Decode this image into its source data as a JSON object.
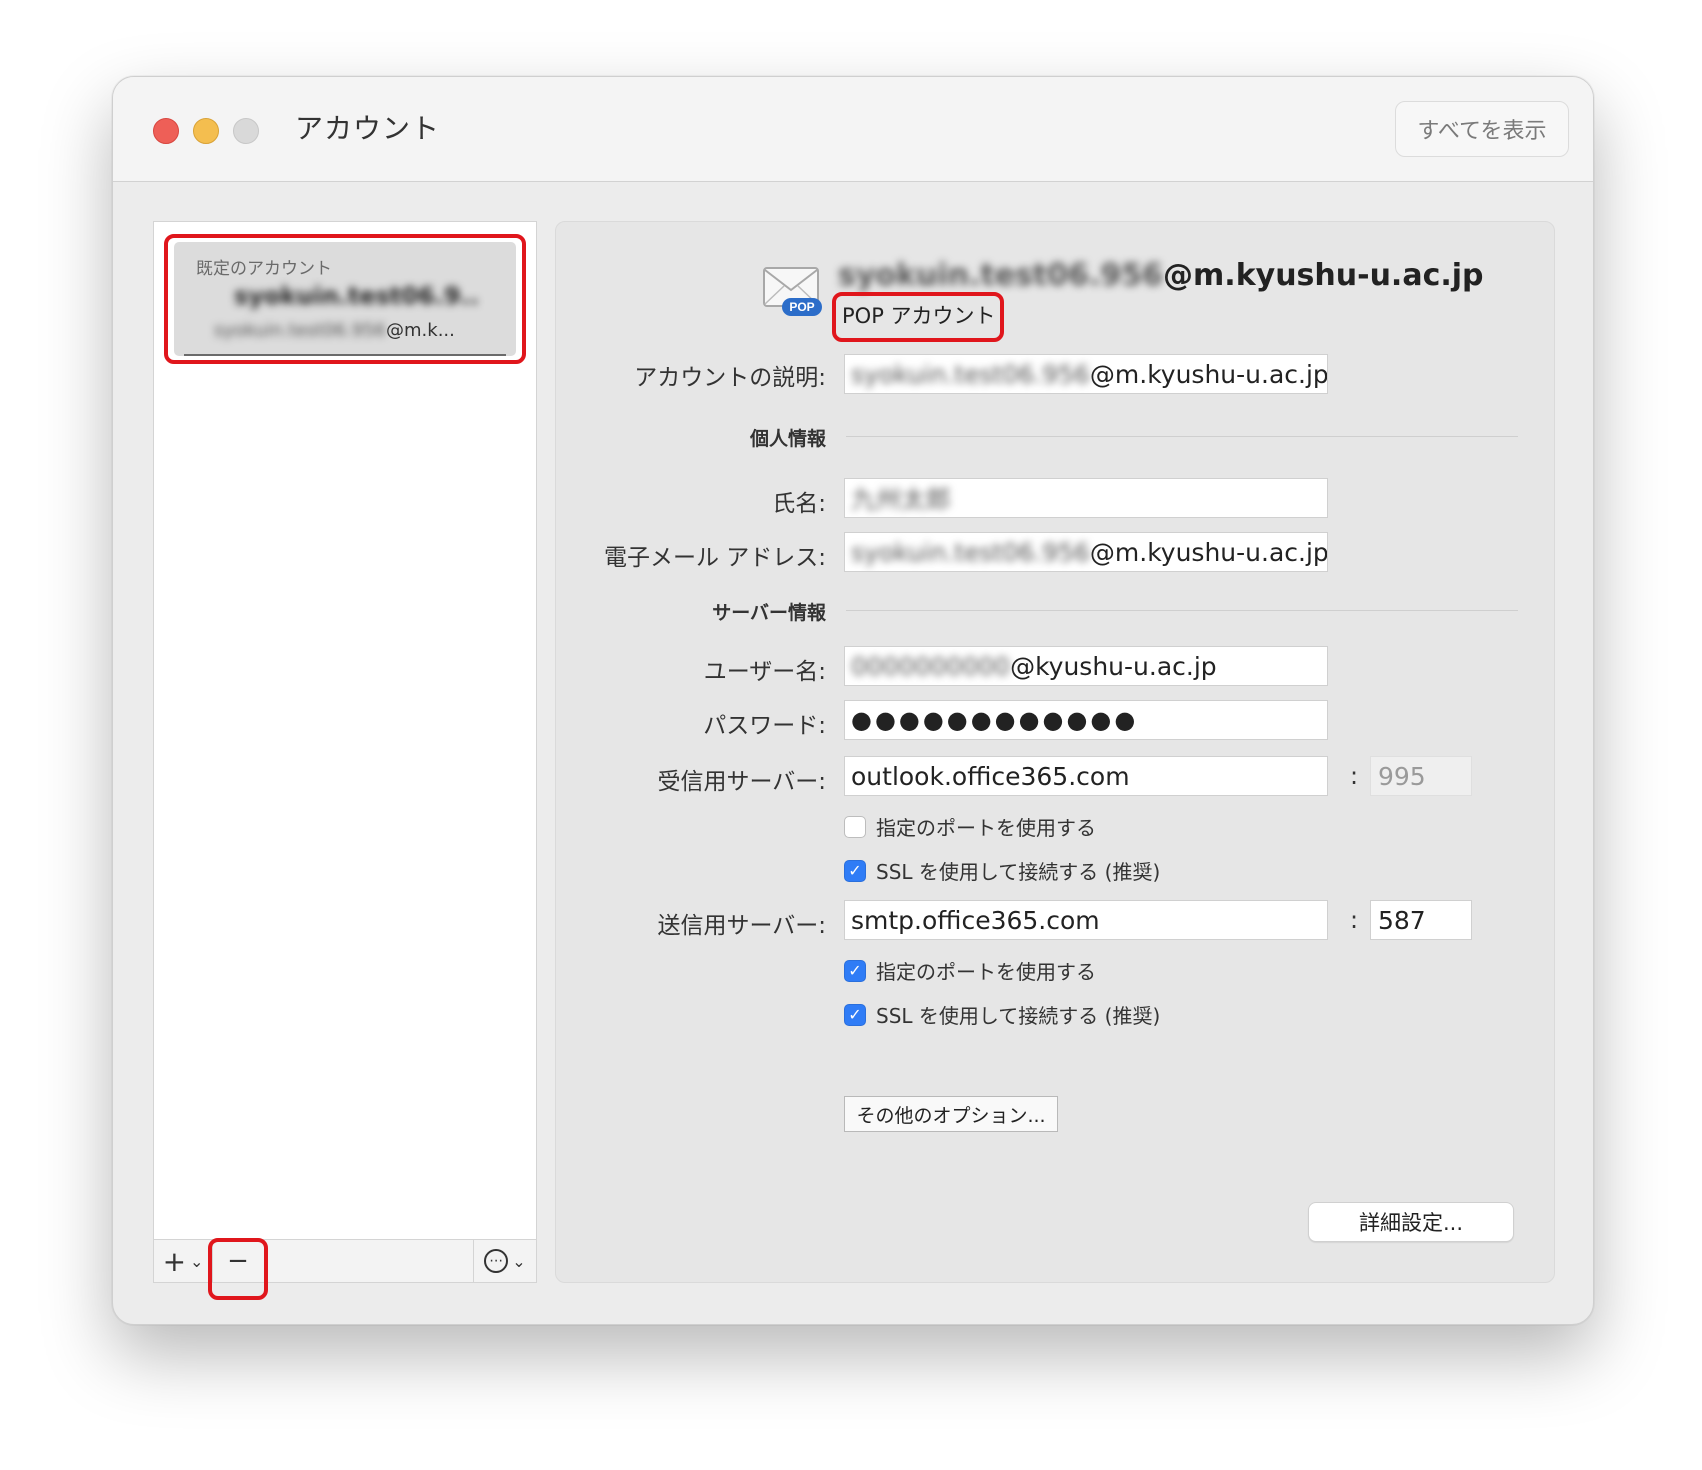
{
  "window": {
    "title": "アカウント",
    "show_all_label": "すべてを表示"
  },
  "sidebar": {
    "section_label": "既定のアカウント",
    "account_name": "syokuin.test06.9..",
    "account_email_blurred": "syokuin.test06.956",
    "account_email_visible": "@m.k...",
    "add_label": "+",
    "remove_label": "−",
    "more_label": "⋯"
  },
  "account": {
    "email_blurred": "syokuin.test06.956",
    "email_domain": "@m.kyushu-u.ac.jp",
    "type": "POP アカウント",
    "icon_badge": "POP"
  },
  "form": {
    "description_label": "アカウントの説明:",
    "description_blurred": "syokuin.test06.956",
    "description_domain": "@m.kyushu-u.ac.jp",
    "personal_section": "個人情報",
    "name_label": "氏名:",
    "name_value_blurred": "九州太郎",
    "email_label": "電子メール アドレス:",
    "email_blurred": "syokuin.test06.956",
    "email_domain": "@m.kyushu-u.ac.jp",
    "server_section": "サーバー情報",
    "username_label": "ユーザー名:",
    "username_blurred": "0000000000",
    "username_domain": "@kyushu-u.ac.jp",
    "password_label": "パスワード:",
    "password_value": "●●●●●●●●●●●●",
    "incoming_label": "受信用サーバー:",
    "incoming_value": "outlook.office365.com",
    "incoming_port": "995",
    "incoming_custom_port_label": "指定のポートを使用する",
    "incoming_custom_port_checked": false,
    "incoming_ssl_label": "SSL を使用して接続する (推奨)",
    "incoming_ssl_checked": true,
    "outgoing_label": "送信用サーバー:",
    "outgoing_value": "smtp.office365.com",
    "outgoing_port": "587",
    "outgoing_custom_port_label": "指定のポートを使用する",
    "outgoing_custom_port_checked": true,
    "outgoing_ssl_label": "SSL を使用して接続する (推奨)",
    "outgoing_ssl_checked": true,
    "colon": ":",
    "more_options_label": "その他のオプション...",
    "advanced_label": "詳細設定..."
  },
  "colors": {
    "highlight": "#e0161c",
    "checkbox": "#2f7cf6"
  }
}
